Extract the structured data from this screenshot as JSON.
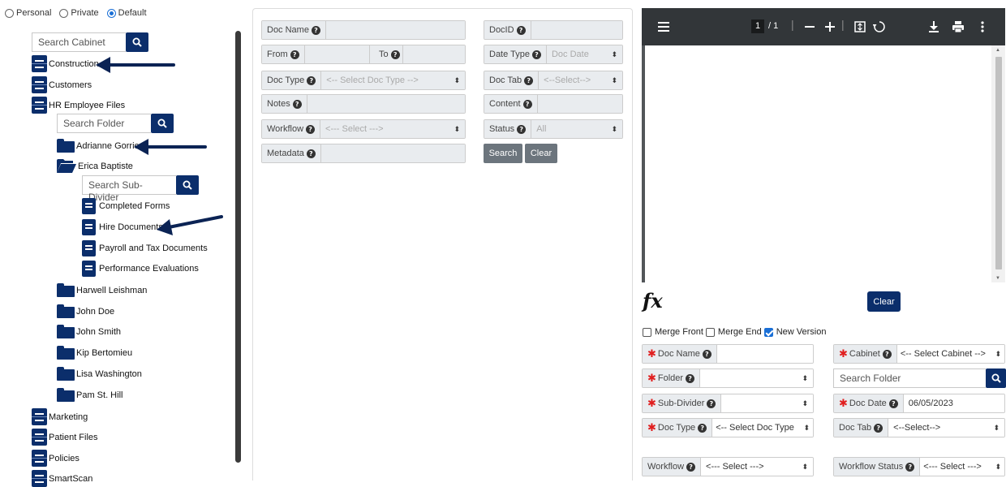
{
  "scope": {
    "options": [
      "Personal",
      "Private",
      "Default"
    ],
    "selected": "Default"
  },
  "cabinet_search": {
    "placeholder": "Search Cabinet"
  },
  "cabinets": [
    {
      "label": "Construction"
    },
    {
      "label": "Customers"
    },
    {
      "label": "HR Employee Files"
    },
    {
      "label": "Marketing"
    },
    {
      "label": "Patient Files"
    },
    {
      "label": "Policies"
    },
    {
      "label": "SmartScan"
    }
  ],
  "folder_search": {
    "placeholder": "Search Folder"
  },
  "folders": [
    {
      "label": "Adrianne Gorrie"
    },
    {
      "label": "Erica Baptiste"
    },
    {
      "label": "Harwell Leishman"
    },
    {
      "label": "John Doe"
    },
    {
      "label": "John Smith"
    },
    {
      "label": "Kip Bertomieu"
    },
    {
      "label": "Lisa Washington"
    },
    {
      "label": "Pam St. Hill"
    }
  ],
  "subdivider_search": {
    "placeholder": "Search Sub-Divider"
  },
  "subdividers": [
    {
      "label": "Completed Forms"
    },
    {
      "label": "Hire Documents"
    },
    {
      "label": "Payroll and Tax Documents"
    },
    {
      "label": "Performance Evaluations"
    }
  ],
  "search_form": {
    "doc_name": "Doc Name",
    "doc_id": "DocID",
    "from": "From",
    "to": "To",
    "date_type": "Date Type",
    "date_type_value": "Doc Date",
    "doc_type": "Doc Type",
    "doc_type_value": "<-- Select Doc Type -->",
    "doc_tab": "Doc Tab",
    "doc_tab_value": "<--Select-->",
    "notes": "Notes",
    "content": "Content",
    "workflow": "Workflow",
    "workflow_value": "<--- Select --->",
    "status": "Status",
    "status_value": "All",
    "metadata": "Metadata",
    "search_btn": "Search",
    "clear_btn": "Clear"
  },
  "viewer": {
    "page_current": "1",
    "page_total": "/ 1"
  },
  "index_form": {
    "fx_label": "fx",
    "clear_btn": "Clear",
    "merge_front": "Merge Front",
    "merge_end": "Merge End",
    "new_version": "New Version",
    "merge_front_checked": false,
    "merge_end_checked": false,
    "new_version_checked": true,
    "doc_name": "Doc Name",
    "cabinet": "Cabinet",
    "cabinet_value": "<-- Select Cabinet -->",
    "folder": "Folder",
    "folder_search_placeholder": "Search Folder",
    "sub_divider": "Sub-Divider",
    "doc_date": "Doc Date",
    "doc_date_value": "06/05/2023",
    "doc_type": "Doc Type",
    "doc_type_value": "<-- Select Doc Type",
    "doc_tab": "Doc Tab",
    "doc_tab_value": "<--Select-->",
    "workflow": "Workflow",
    "workflow_value": "<--- Select --->",
    "workflow_status": "Workflow Status",
    "workflow_status_value": "<--- Select --->"
  },
  "colors": {
    "navy": "#0b2e6b",
    "required": "#e01e1e",
    "label_bg": "#e9ecef",
    "viewer_bar": "#323639"
  }
}
